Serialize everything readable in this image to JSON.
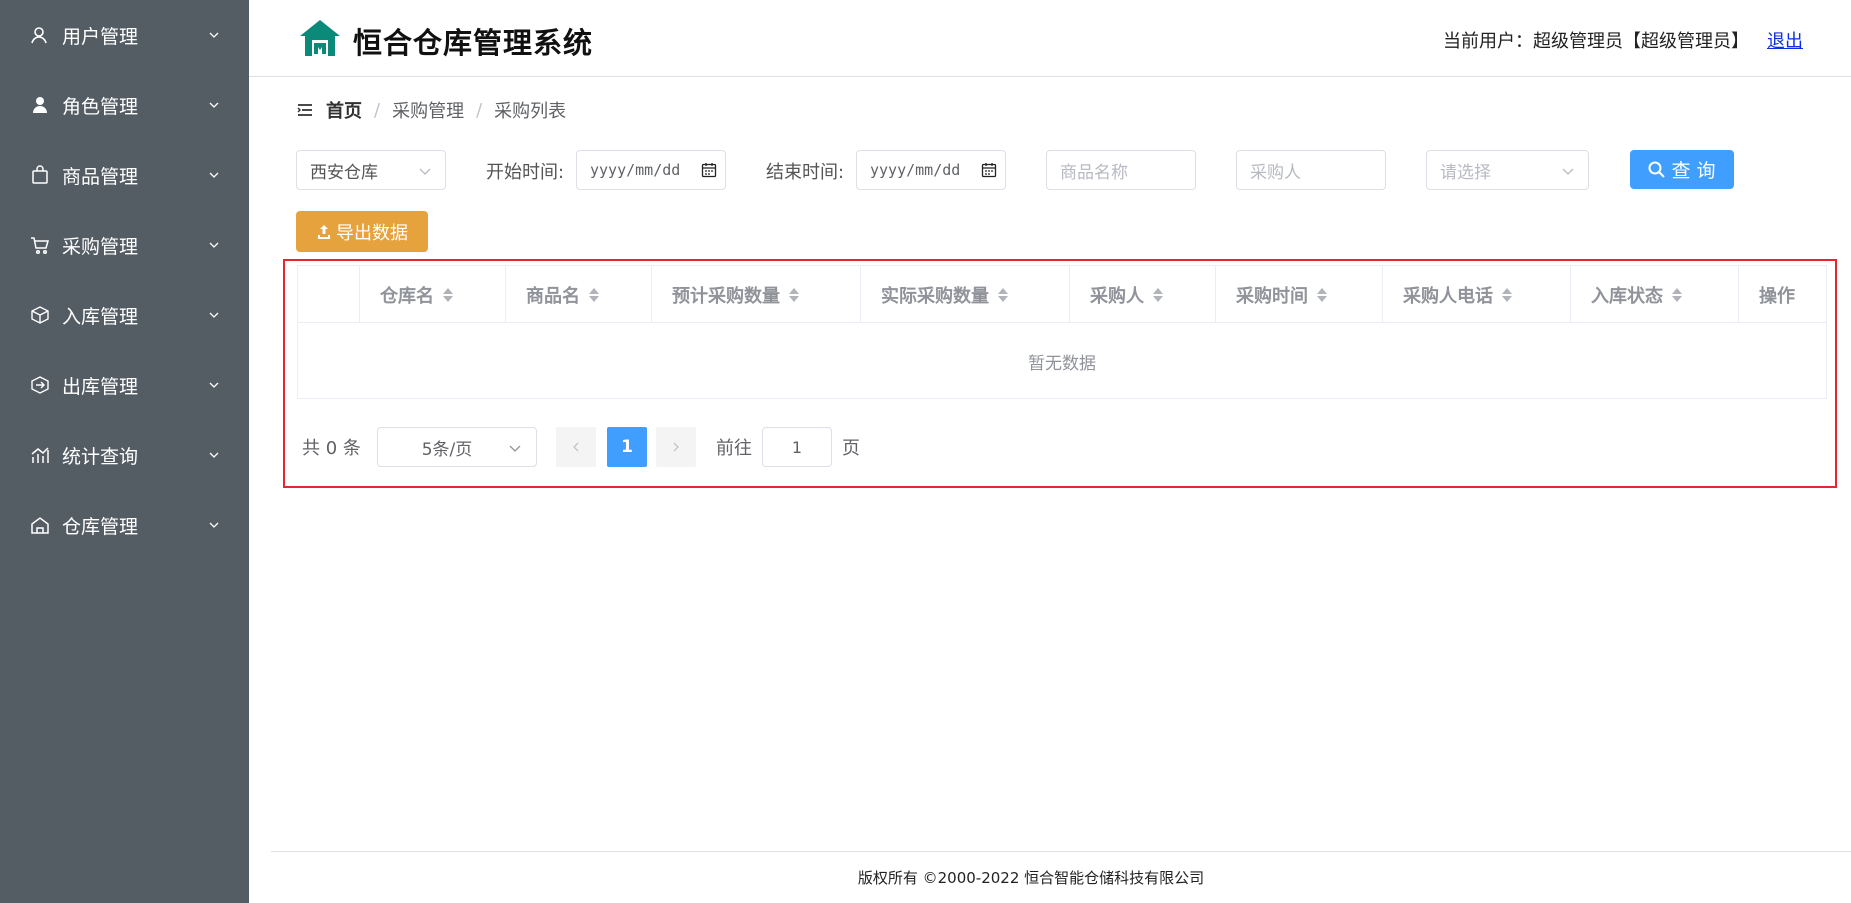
{
  "colors": {
    "sidebar_bg": "#545c64",
    "primary": "#409eff",
    "warning": "#e6a23c",
    "brand_green": "#0b8a7a",
    "highlight": "#e8262f"
  },
  "sidebar": {
    "items": [
      {
        "label": "用户管理",
        "icon": "user-icon"
      },
      {
        "label": "角色管理",
        "icon": "role-icon"
      },
      {
        "label": "商品管理",
        "icon": "bag-icon"
      },
      {
        "label": "采购管理",
        "icon": "cart-icon"
      },
      {
        "label": "入库管理",
        "icon": "box-in-icon"
      },
      {
        "label": "出库管理",
        "icon": "box-out-icon"
      },
      {
        "label": "统计查询",
        "icon": "chart-icon"
      },
      {
        "label": "仓库管理",
        "icon": "warehouse-icon"
      }
    ]
  },
  "header": {
    "title": "恒合仓库管理系统",
    "user_label": "当前用户：超级管理员【超级管理员】",
    "logout": "退出"
  },
  "breadcrumb": {
    "home": "首页",
    "level1": "采购管理",
    "level2": "采购列表",
    "separator": "/"
  },
  "filters": {
    "warehouse_value": "西安仓库",
    "start_label": "开始时间:",
    "start_value": "yyyy/mm/dd",
    "end_label": "结束时间:",
    "end_value": "yyyy/mm/dd",
    "product_placeholder": "商品名称",
    "buyer_placeholder": "采购人",
    "select_placeholder": "请选择",
    "search_label": "查 询"
  },
  "export_label": "导出数据",
  "table": {
    "columns": [
      "仓库名",
      "商品名",
      "预计采购数量",
      "实际采购数量",
      "采购人",
      "采购时间",
      "采购人电话",
      "入库状态",
      "操作"
    ],
    "rows": [],
    "empty_text": "暂无数据"
  },
  "pagination": {
    "total": "共 0 条",
    "page_size": "5条/页",
    "current_page": "1",
    "goto_label": "前往",
    "goto_value": "1",
    "page_suffix": "页"
  },
  "footer": {
    "copyright": "版权所有 ©2000-2022  恒合智能仓储科技有限公司"
  }
}
